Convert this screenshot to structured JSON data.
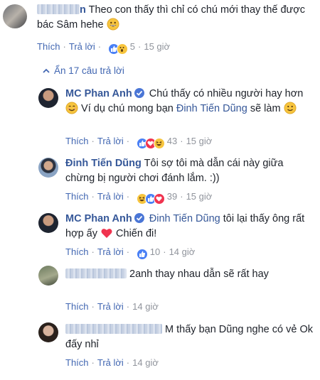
{
  "comments": [
    {
      "name_visible": "n",
      "text": "Theo con thấy thì chỉ có chú mới thay thế được bác Sâm hehe",
      "like_label": "Thích",
      "reply_label": "Trả lời",
      "reaction_count": "5",
      "time": "15 giờ"
    }
  ],
  "toggle_replies": {
    "label": "Ẩn 17 câu trả lời",
    "icon": "chevron-up-icon"
  },
  "replies": [
    {
      "author": "MC Phan Anh",
      "text_1": "Chú thấy có nhiều người hay hơn",
      "text_2": "Ví dụ chú mong bạn",
      "mention": "Đinh Tiến Dũng",
      "text_3": "sẽ làm",
      "like_label": "Thích",
      "reply_label": "Trả lời",
      "reaction_count": "43",
      "time": "15 giờ"
    },
    {
      "author": "Đinh Tiến Dũng",
      "text": "Tôi sợ tôi mà dẫn cái này giữa chừng bị người chơi đánh lắm. :))",
      "like_label": "Thích",
      "reply_label": "Trả lời",
      "reaction_count": "39",
      "time": "15 giờ"
    },
    {
      "author": "MC Phan Anh",
      "mention": "Đinh Tiến Dũng",
      "text_1": "tôi lại thấy ông rất hợp ấy",
      "text_2": "Chiến đi!",
      "like_label": "Thích",
      "reply_label": "Trả lời",
      "reaction_count": "10",
      "time": "14 giờ"
    },
    {
      "text": "2anh thay nhau dẫn sẽ rất hay",
      "like_label": "Thích",
      "reply_label": "Trả lời",
      "time": "14 giờ"
    },
    {
      "text_1": "M thấy bạn Dũng nghe",
      "text_2": "có vẻ Ok đấy nhỉ",
      "like_label": "Thích",
      "reply_label": "Trả lời",
      "time": "14 giờ"
    }
  ],
  "colors": {
    "link": "#365899",
    "action": "#4267b2",
    "meta": "#90949c",
    "like": "#4a80f5",
    "love": "#f0334f",
    "wow": "#f7c53e"
  }
}
